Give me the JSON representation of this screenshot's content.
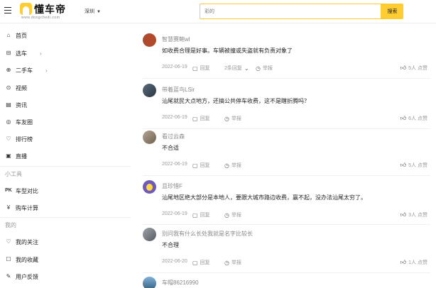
{
  "header": {
    "logo_text": "懂车帝",
    "logo_sub": "www.dongchedi.com",
    "city": "深圳",
    "search_placeholder": "彩的",
    "search_button": "搜索"
  },
  "sidebar": {
    "nav": [
      {
        "label": "首页",
        "icon": "home-icon",
        "glyph": "⌂"
      },
      {
        "label": "选车",
        "icon": "car-select-icon",
        "glyph": "⊟",
        "arrow": "›"
      },
      {
        "label": "二手车",
        "icon": "used-car-icon",
        "glyph": "⊕",
        "arrow": "›"
      },
      {
        "label": "视频",
        "icon": "video-icon",
        "glyph": "⊙"
      },
      {
        "label": "资讯",
        "icon": "news-icon",
        "glyph": "▤"
      },
      {
        "label": "车友圈",
        "icon": "community-icon",
        "glyph": "◎"
      },
      {
        "label": "排行榜",
        "icon": "ranking-icon",
        "glyph": "♡"
      },
      {
        "label": "直播",
        "icon": "live-icon",
        "glyph": "▣"
      }
    ],
    "tools_title": "小工具",
    "tools": [
      {
        "label": "车型对比",
        "icon": "compare-icon",
        "glyph": "PK"
      },
      {
        "label": "购车计算",
        "icon": "calculator-icon",
        "glyph": "¥"
      }
    ],
    "mine_title": "我的",
    "mine": [
      {
        "label": "我的关注",
        "icon": "follow-icon",
        "glyph": "♡"
      },
      {
        "label": "我的收藏",
        "icon": "favorite-icon",
        "glyph": "☐"
      },
      {
        "label": "用户反馈",
        "icon": "feedback-icon",
        "glyph": "✎"
      }
    ]
  },
  "comments": [
    {
      "user": "智慧赛鲍wl",
      "text": "如收费合理是好事。车辆被撞或失盗就有负责对象了",
      "date": "2022-06-19",
      "reply": "回复",
      "replies": "2条回复",
      "report": "举报",
      "likes": "5人 点赞",
      "avatar_color": "#b04a2c"
    },
    {
      "user": "带着蓝鸟LSir",
      "text": "汕尾就民大点地方，还搞公共停车收费，这不是瞎折腾吗？",
      "date": "2022-06-19",
      "reply": "回复",
      "report": "举报",
      "likes": "6人 点赞",
      "avatar_color": "#3a4a5c"
    },
    {
      "user": "看过云森",
      "text": "不合适",
      "date": "2022-06-19",
      "reply": "回复",
      "report": "举报",
      "likes": "5人 点赞",
      "avatar_color": "#8c7a6a"
    },
    {
      "user": "且珍惜F",
      "text": "汕尾地区绝大部分是本地人，要跟大城市路边收费，赢不起，没办法汕尾太穷了。",
      "date": "2022-06-19",
      "reply": "回复",
      "report": "举报",
      "likes": "3人 点赞",
      "avatar_color": "#6f5ab8"
    },
    {
      "user": "别问我有什么长处我就是名字比较长",
      "text": "不合理",
      "date": "2022-06-20",
      "reply": "回复",
      "report": "举报",
      "likes": "1人 点赞",
      "avatar_color": "#7a7f86"
    },
    {
      "user": "车帽86216990",
      "text": "",
      "date": "",
      "avatar_color": "#4f7fa8"
    }
  ]
}
